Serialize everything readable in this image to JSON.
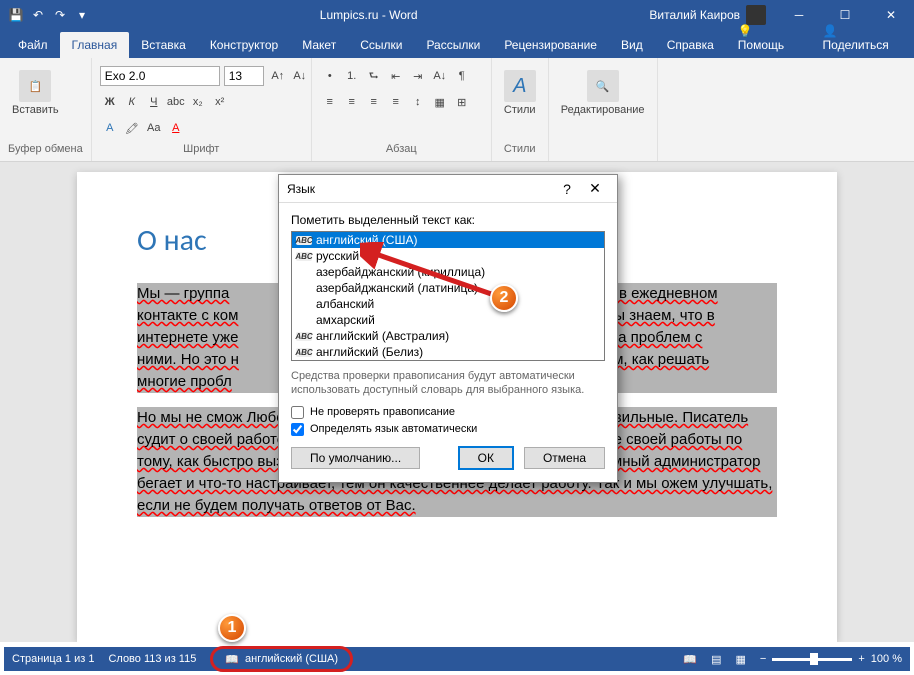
{
  "titlebar": {
    "title": "Lumpics.ru - Word",
    "user": "Виталий Каиров"
  },
  "tabs": {
    "file": "Файл",
    "home": "Главная",
    "insert": "Вставка",
    "design": "Конструктор",
    "layout": "Макет",
    "references": "Ссылки",
    "mailings": "Рассылки",
    "review": "Рецензирование",
    "view": "Вид",
    "help": "Справка",
    "assist": "Помощь",
    "share": "Поделиться"
  },
  "ribbon": {
    "clipboard": {
      "label": "Буфер обмена",
      "paste": "Вставить"
    },
    "font": {
      "label": "Шрифт",
      "name": "Exo 2.0",
      "size": "13"
    },
    "paragraph": {
      "label": "Абзац"
    },
    "styles": {
      "label": "Стили"
    },
    "editing": {
      "label": "Редактирование"
    }
  },
  "doc": {
    "heading": "О нас",
    "p1a": "Мы — группа",
    "p1b": "ам в ежедневном",
    "p2a": "контакте с ком",
    "p2b": "Мы знаем, что в",
    "p3a": "интернете уже",
    "p3b": "да проблем с",
    "p4a": "ними. Но это н",
    "p4b": "Вам, как решать",
    "p5": "многие пробл",
    "p6": "Но мы не смож                                                                    Любому человеку важно знать, что его действия правильные. Писатель судит о своей работе по отзывам читателей. Доктор судит о качестве своей работы по тому, как быстро выздоравливают его пациенты. Чем меньше системный администратор бегает и что-то настраивает, тем он качественнее делает работу. Так и мы          ожем улучшать, если не будем получать ответов от Вас."
  },
  "dialog": {
    "title": "Язык",
    "label": "Пометить выделенный текст как:",
    "languages": [
      "английский (США)",
      "русский",
      "азербайджанский (кириллица)",
      "азербайджанский (латиница)",
      "албанский",
      "амхарский",
      "английский (Австралия)",
      "английский (Белиз)"
    ],
    "helptext": "Средства проверки правописания будут автоматически использовать доступный словарь для выбранного языка.",
    "check1": "Не проверять правописание",
    "check2": "Определять язык автоматически",
    "btn_default": "По умолчанию...",
    "btn_ok": "ОК",
    "btn_cancel": "Отмена"
  },
  "status": {
    "page": "Страница 1 из 1",
    "words": "Слово 113 из 115",
    "lang": "английский (США)",
    "zoom": "100 %"
  }
}
